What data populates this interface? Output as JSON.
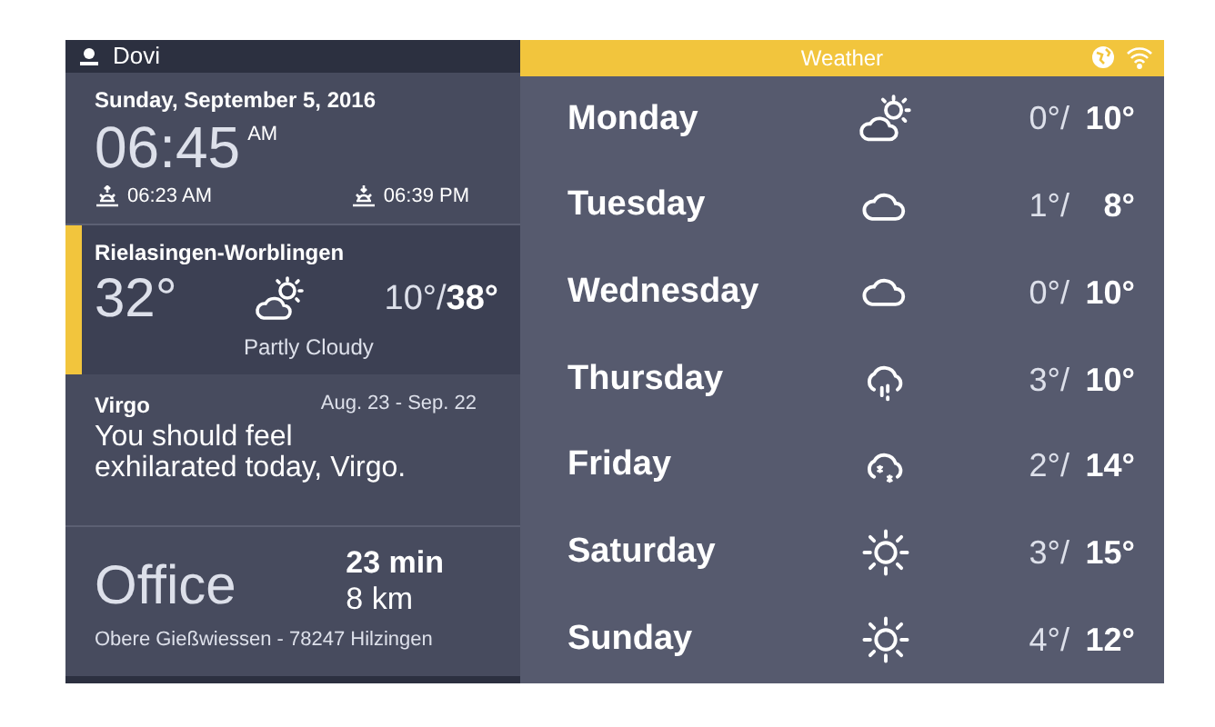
{
  "header": {
    "user": "Dovi"
  },
  "clock": {
    "date": "Sunday, September 5, 2016",
    "time": "06:45",
    "ampm": "AM",
    "sunrise": "06:23 AM",
    "sunset": "06:39 PM"
  },
  "location": {
    "city": "Rielasingen-Worblingen",
    "temp": "32°",
    "kind": "partly_cloudy",
    "low": "10°/",
    "high": "38°",
    "condition": "Partly Cloudy"
  },
  "horoscope": {
    "sign": "Virgo",
    "dates": "Aug. 23 - Sep. 22",
    "text": "You should feel exhilarated today, Virgo."
  },
  "commute": {
    "place": "Office",
    "duration": "23 min",
    "distance": "8 km",
    "address": "Obere Gießwiessen - 78247 Hilzingen"
  },
  "weather": {
    "title": "Weather",
    "days": [
      {
        "day": "Monday",
        "kind": "partly_cloudy",
        "low": "0°/",
        "high": "10°"
      },
      {
        "day": "Tuesday",
        "kind": "cloudy",
        "low": "1°/",
        "high": "8°"
      },
      {
        "day": "Wednesday",
        "kind": "cloudy",
        "low": "0°/",
        "high": "10°"
      },
      {
        "day": "Thursday",
        "kind": "rain",
        "low": "3°/",
        "high": "10°"
      },
      {
        "day": "Friday",
        "kind": "snow",
        "low": "2°/",
        "high": "14°"
      },
      {
        "day": "Saturday",
        "kind": "sunny",
        "low": "3°/",
        "high": "15°"
      },
      {
        "day": "Sunday",
        "kind": "sunny",
        "low": "4°/",
        "high": "12°"
      }
    ]
  }
}
